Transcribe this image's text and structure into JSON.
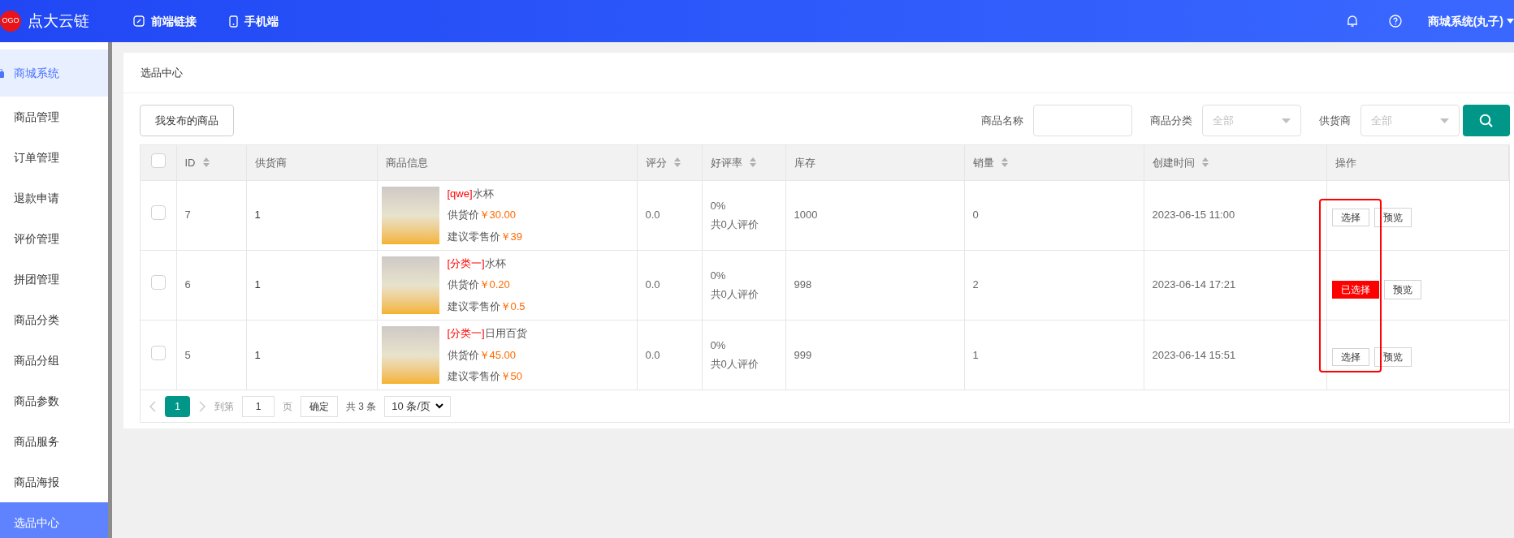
{
  "header": {
    "logo_badge": "OGO",
    "brand": "点大云链",
    "nav": [
      {
        "label": "前端链接",
        "kind": "link"
      },
      {
        "label": "手机端",
        "kind": "phone"
      }
    ],
    "user": "商城系统(丸子)"
  },
  "sidebar": {
    "items": [
      {
        "label": "商城系统",
        "selected": false,
        "kind": "group"
      },
      {
        "label": "商品管理",
        "selected": false,
        "kind": "item"
      },
      {
        "label": "订单管理",
        "selected": false,
        "kind": "item"
      },
      {
        "label": "退款申请",
        "selected": false,
        "kind": "item"
      },
      {
        "label": "评价管理",
        "selected": false,
        "kind": "item"
      },
      {
        "label": "拼团管理",
        "selected": false,
        "kind": "item"
      },
      {
        "label": "商品分类",
        "selected": false,
        "kind": "item"
      },
      {
        "label": "商品分组",
        "selected": false,
        "kind": "item"
      },
      {
        "label": "商品参数",
        "selected": false,
        "kind": "item"
      },
      {
        "label": "商品服务",
        "selected": false,
        "kind": "item"
      },
      {
        "label": "商品海报",
        "selected": false,
        "kind": "item"
      },
      {
        "label": "选品中心",
        "selected": true,
        "kind": "item"
      }
    ]
  },
  "page_title": "选品中心",
  "toolbar": {
    "my_products_button": "我发布的商品",
    "filters": [
      {
        "label": "商品名称",
        "kind": "input"
      },
      {
        "label": "商品分类",
        "kind": "select",
        "placeholder": "全部"
      },
      {
        "label": "供货商",
        "kind": "select",
        "placeholder": "全部"
      }
    ]
  },
  "table": {
    "header_checked": false,
    "columns": [
      {
        "label": "ID",
        "sortable": true
      },
      {
        "label": "供货商",
        "sortable": false
      },
      {
        "label": "商品信息",
        "sortable": false
      },
      {
        "label": "评分",
        "sortable": true
      },
      {
        "label": "好评率",
        "sortable": true
      },
      {
        "label": "库存",
        "sortable": false
      },
      {
        "label": "销量",
        "sortable": true
      },
      {
        "label": "创建时间",
        "sortable": true
      },
      {
        "label": "操作",
        "sortable": false
      }
    ],
    "rows": [
      {
        "checked": false,
        "id": "7",
        "supplier": "1",
        "tag": "[qwe]",
        "name": "水杯",
        "supply_label": "供货价",
        "supply_price": "￥30.00",
        "retail_label": "建议零售价",
        "retail_price": "￥39",
        "rating": "0.0",
        "positive_rate": "0%",
        "review_count": "共0人评价",
        "stock": "1000",
        "sales": "0",
        "created": "2023-06-15 11:00",
        "chosen": false,
        "select_button": "选择",
        "preview_button": "预览"
      },
      {
        "checked": false,
        "id": "6",
        "supplier": "1",
        "tag": "[分类一]",
        "name": "水杯",
        "supply_label": "供货价",
        "supply_price": "￥0.20",
        "retail_label": "建议零售价",
        "retail_price": "￥0.5",
        "rating": "0.0",
        "positive_rate": "0%",
        "review_count": "共0人评价",
        "stock": "998",
        "sales": "2",
        "created": "2023-06-14 17:21",
        "chosen": true,
        "select_button": "已选择",
        "preview_button": "预览"
      },
      {
        "checked": false,
        "id": "5",
        "supplier": "1",
        "tag": "[分类一]",
        "name": "日用百货",
        "supply_label": "供货价",
        "supply_price": "￥45.00",
        "retail_label": "建议零售价",
        "retail_price": "￥50",
        "rating": "0.0",
        "positive_rate": "0%",
        "review_count": "共0人评价",
        "stock": "999",
        "sales": "1",
        "created": "2023-06-14 15:51",
        "chosen": false,
        "select_button": "选择",
        "preview_button": "预览"
      }
    ]
  },
  "pagination": {
    "pages": [
      {
        "label": "1",
        "selected": true
      }
    ],
    "goto_label": "到第",
    "goto_value": "1",
    "page_unit": "页",
    "confirm_button": "确定",
    "total": "共 3 条",
    "page_size": "10 条/页"
  }
}
